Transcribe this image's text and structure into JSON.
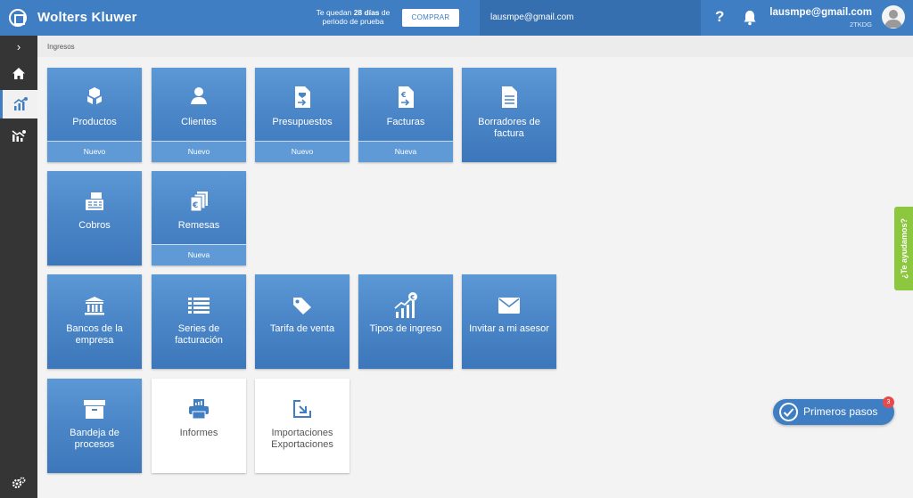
{
  "header": {
    "brand": "Wolters Kluwer",
    "trial_prefix": "Te quedan ",
    "trial_days": "28 días",
    "trial_suffix": " de",
    "trial_line2": "periodo de prueba",
    "buy_label": "COMPRAR",
    "company_email": "lausmpe@gmail.com",
    "help_label": "?",
    "user_email": "lausmpe@gmail.com",
    "user_code": "2TKDG"
  },
  "sidebar": {
    "toggle_label": "›"
  },
  "breadcrumb": "Ingresos",
  "tiles": [
    {
      "label": "Productos",
      "footer": "Nuevo",
      "icon": "boxes-icon"
    },
    {
      "label": "Clientes",
      "footer": "Nuevo",
      "icon": "user-icon"
    },
    {
      "label": "Presupuestos",
      "footer": "Nuevo",
      "icon": "quote-doc-icon"
    },
    {
      "label": "Facturas",
      "footer": "Nueva",
      "icon": "invoice-doc-icon"
    },
    {
      "label": "Borradores de factura",
      "footer": "",
      "icon": "draft-doc-icon"
    },
    {
      "label": "Cobros",
      "footer": "",
      "icon": "cash-register-icon"
    },
    {
      "label": "Remesas",
      "footer": "Nueva",
      "icon": "euro-stack-icon"
    },
    {
      "label": "Bancos de la empresa",
      "footer": "",
      "icon": "bank-icon"
    },
    {
      "label": "Series de facturación",
      "footer": "",
      "icon": "list-icon"
    },
    {
      "label": "Tarifa de venta",
      "footer": "",
      "icon": "tag-icon"
    },
    {
      "label": "Tipos de ingreso",
      "footer": "",
      "icon": "growth-euro-icon"
    },
    {
      "label": "Invitar a mi asesor",
      "footer": "",
      "icon": "envelope-icon"
    },
    {
      "label": "Bandeja de procesos",
      "footer": "",
      "icon": "archive-box-icon"
    },
    {
      "label": "Informes",
      "footer": "",
      "icon": "printer-icon"
    },
    {
      "label": "Importaciones Exportaciones",
      "footer": "",
      "icon": "import-arrow-icon"
    }
  ],
  "help_tab": "¿Te ayudamos?",
  "first_steps": {
    "label": "Primeros pasos",
    "badge": "3"
  },
  "colors": {
    "primary": "#3f7ec2",
    "sidebar": "#353535",
    "help_tab": "#8dc63f",
    "badge": "#e64b4b"
  }
}
